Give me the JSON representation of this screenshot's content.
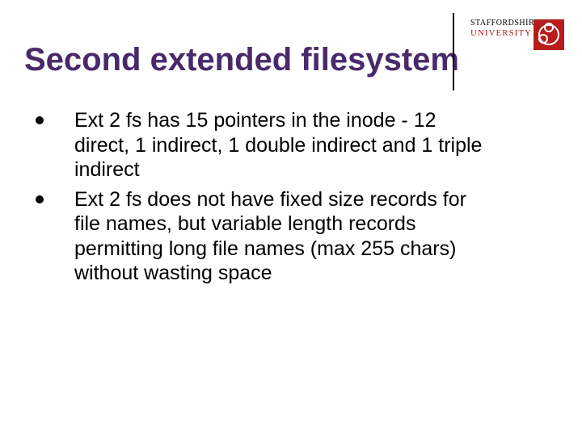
{
  "title": "Second extended filesystem",
  "logo": {
    "line1": "STAFFORDSHIRE",
    "line2": "UNIVERSITY"
  },
  "bullets": [
    "Ext 2 fs has 15 pointers in the inode - 12 direct, 1 indirect, 1 double indirect and 1 triple indirect",
    "Ext 2 fs does not have fixed size records for file names, but variable length records permitting long file names (max 255 chars) without wasting space"
  ]
}
